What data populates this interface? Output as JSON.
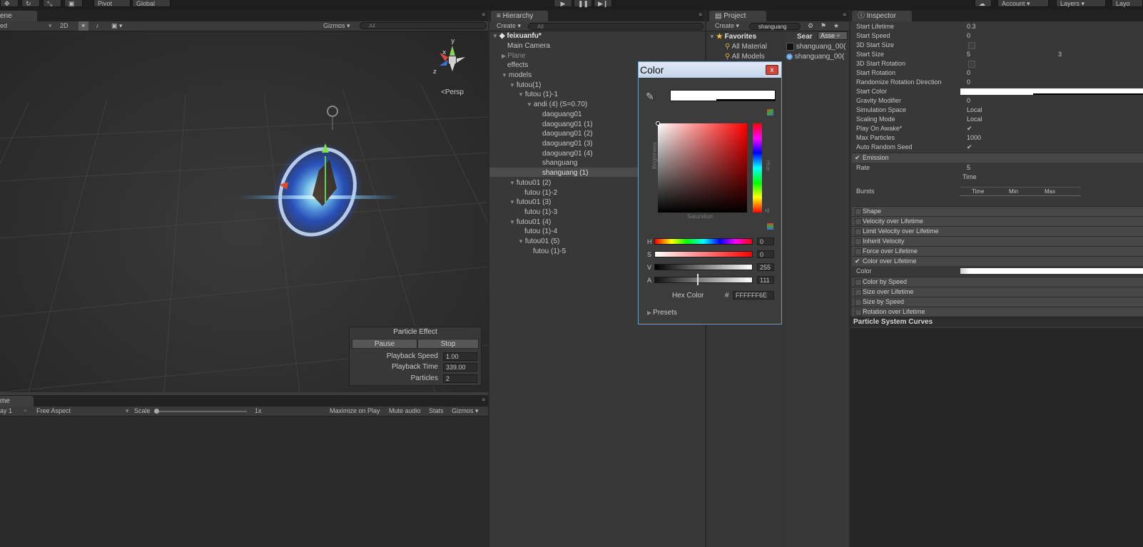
{
  "toolbar": {
    "pivot": "Pivot",
    "global": "Global",
    "account": "Account",
    "layers": "Layers",
    "layout": "Layo"
  },
  "scene": {
    "tab": "ene",
    "draw_mode": "ed",
    "mode_2d": "2D",
    "gizmos": "Gizmos",
    "search_placeholder": "All",
    "persp": "Persp",
    "axis_y": "y",
    "axis_x": "x",
    "axis_z": "z"
  },
  "particle_effect": {
    "title": "Particle Effect",
    "pause": "Pause",
    "stop": "Stop",
    "rows": [
      {
        "label": "Playback Speed",
        "value": "1.00"
      },
      {
        "label": "Playback Time",
        "value": "339.00"
      },
      {
        "label": "Particles",
        "value": "2"
      }
    ]
  },
  "game": {
    "tab": "me",
    "display": "ay 1",
    "aspect": "Free Aspect",
    "scale_label": "Scale",
    "scale_value": "1x",
    "maximize": "Maximize on Play",
    "mute": "Mute audio",
    "stats": "Stats",
    "gizmos": "Gizmos"
  },
  "hierarchy": {
    "tab": "Hierarchy",
    "create": "Create",
    "search_placeholder": "All",
    "scene_name": "feixuanfu*",
    "items": [
      {
        "label": "Main Camera"
      },
      {
        "label": "Plane"
      },
      {
        "label": "effects"
      },
      {
        "label": "models"
      },
      {
        "label": "futou(1)"
      },
      {
        "label": "futou (1)-1"
      },
      {
        "label": "andi (4) (S=0.70)"
      },
      {
        "label": "daoguang01"
      },
      {
        "label": "daoguang01 (1)"
      },
      {
        "label": "daoguang01 (2)"
      },
      {
        "label": "daoguang01 (3)"
      },
      {
        "label": "daoguang01 (4)"
      },
      {
        "label": "shanguang"
      },
      {
        "label": "shanguang (1)"
      },
      {
        "label": "futou01 (2)"
      },
      {
        "label": "futou (1)-2"
      },
      {
        "label": "futou01 (3)"
      },
      {
        "label": "futou (1)-3"
      },
      {
        "label": "futou01 (4)"
      },
      {
        "label": "futou (1)-4"
      },
      {
        "label": "futou01 (5)"
      },
      {
        "label": "futou (1)-5"
      }
    ]
  },
  "project": {
    "tab": "Project",
    "create": "Create",
    "search_value": "shanguang",
    "favorites": "Favorites",
    "all_material": "All Material",
    "all_models": "All Models",
    "search_label": "Sear",
    "assets_dropdown": "Asse",
    "results": [
      "shanguang_00(",
      "shanguang_00("
    ]
  },
  "inspector": {
    "tab": "Inspector",
    "rows": [
      {
        "label": "Start Lifetime",
        "value": "0.3"
      },
      {
        "label": "Start Speed",
        "value": "0"
      },
      {
        "label": "3D Start Size",
        "value": ""
      },
      {
        "label": "Start Size",
        "value": "5",
        "value2": "3"
      },
      {
        "label": "3D Start Rotation",
        "value": ""
      },
      {
        "label": "Start Rotation",
        "value": "0"
      },
      {
        "label": "Randomize Rotation Direction",
        "value": "0"
      },
      {
        "label": "Start Color",
        "value": ""
      },
      {
        "label": "Gravity Modifier",
        "value": "0"
      },
      {
        "label": "Simulation Space",
        "value": "Local"
      },
      {
        "label": "Scaling Mode",
        "value": "Local"
      },
      {
        "label": "Play On Awake*",
        "value": "✔"
      },
      {
        "label": "Max Particles",
        "value": "1000"
      },
      {
        "label": "Auto Random Seed",
        "value": "✔"
      }
    ],
    "emission": "Emission",
    "rate_label": "Rate",
    "rate_value": "5",
    "time_label": "Time",
    "bursts_label": "Bursts",
    "bursts_cols": [
      "Time",
      "Min",
      "Max"
    ],
    "modules_a": [
      "Shape",
      "Velocity over Lifetime",
      "Limit Velocity over Lifetime",
      "Inherit Velocity",
      "Force over Lifetime"
    ],
    "color_over_lifetime": "Color over Lifetime",
    "color_label": "Color",
    "modules_b": [
      "Color by Speed",
      "Size over Lifetime",
      "Size by Speed",
      "Rotation over Lifetime"
    ],
    "curves": "Particle System Curves"
  },
  "color_dialog": {
    "title": "Color",
    "close": "x",
    "brightness": "Brightness",
    "saturation": "Saturation",
    "hue": "Hue",
    "sliders": [
      {
        "label": "H",
        "value": "0"
      },
      {
        "label": "S",
        "value": "0"
      },
      {
        "label": "V",
        "value": "255"
      },
      {
        "label": "A",
        "value": "111"
      }
    ],
    "hex_label": "Hex Color",
    "hex_hash": "#",
    "hex_value": "FFFFFF6E",
    "presets": "Presets",
    "alpha_fraction": 0.435
  }
}
